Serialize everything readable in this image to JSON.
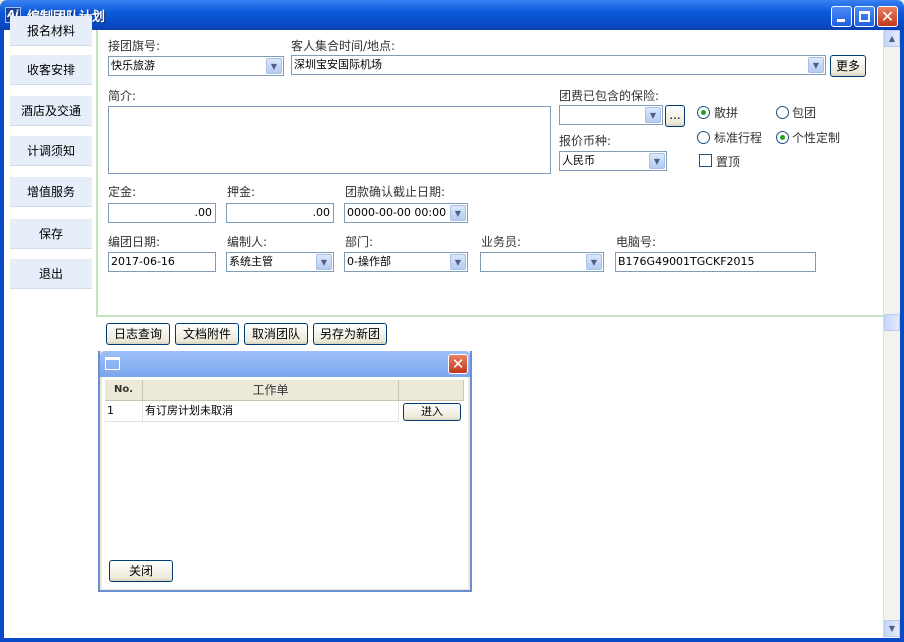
{
  "window": {
    "title": "编制团队计划",
    "app_icon": "Ai"
  },
  "sidebar": {
    "items": [
      {
        "label": "报名材料"
      },
      {
        "label": "收客安排"
      },
      {
        "label": "酒店及交通"
      },
      {
        "label": "计调须知"
      },
      {
        "label": "增值服务"
      },
      {
        "label": "保存"
      },
      {
        "label": "退出"
      }
    ]
  },
  "form": {
    "tour_flag_label": "接团旗号:",
    "tour_flag_value": "快乐旅游",
    "gather_label": "客人集合时间/地点:",
    "gather_value": "深圳宝安国际机场",
    "more_button": "更多",
    "intro_label": "简介:",
    "insurance_label": "团费已包含的保险:",
    "insurance_value": "",
    "ellipsis_button": "...",
    "currency_label": "报价币种:",
    "currency_value": "人民币",
    "radio_loose": "散拼",
    "radio_charter": "包团",
    "radio_standard": "标准行程",
    "radio_custom": "个性定制",
    "pin_label": "置顶",
    "radio_loose_checked": true,
    "radio_custom_checked": true,
    "deposit_label": "定金:",
    "deposit_value": ".00",
    "guarantee_label": "押金:",
    "guarantee_value": ".00",
    "deadline_label": "团款确认截止日期:",
    "deadline_value": "0000-00-00 00:00",
    "date_label": "编团日期:",
    "date_value": "2017-06-16",
    "editor_label": "编制人:",
    "editor_value": "系统主管",
    "dept_label": "部门:",
    "dept_value": "0-操作部",
    "sales_label": "业务员:",
    "sales_value": "",
    "pc_label": "电脑号:",
    "pc_value": "B176G49001TGCKF2015"
  },
  "actions": {
    "log_query": "日志查询",
    "doc_attach": "文档附件",
    "cancel_team": "取消团队",
    "save_as_new": "另存为新团"
  },
  "dialog": {
    "title": "",
    "columns": [
      "No.",
      "工作单",
      ""
    ],
    "rows": [
      {
        "no": "1",
        "task": "有订房计划未取消",
        "action": "进入"
      }
    ],
    "close_button": "关闭"
  }
}
